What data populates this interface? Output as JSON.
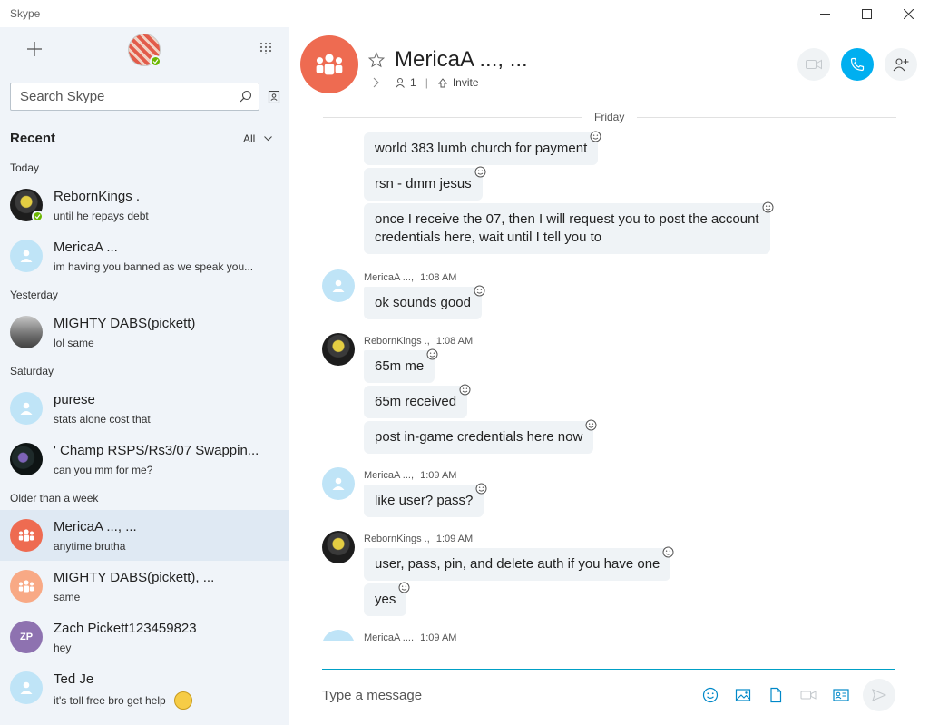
{
  "window": {
    "title": "Skype"
  },
  "sidebar": {
    "search": {
      "placeholder": "Search Skype"
    },
    "recent": {
      "title": "Recent",
      "filter": "All"
    },
    "sections": {
      "today": "Today",
      "yesterday": "Yesterday",
      "saturday": "Saturday",
      "older": "Older than a week"
    },
    "conversations": [
      {
        "name": "RebornKings .",
        "preview": "until he repays debt"
      },
      {
        "name": "MericaA ...",
        "preview": "im having you banned as we speak you..."
      },
      {
        "name": "MIGHTY DABS(pickett)",
        "preview": "lol same"
      },
      {
        "name": "purese",
        "preview": "stats alone cost that"
      },
      {
        "name": "' Champ RSPS/Rs3/07 Swappin...",
        "preview": "can you mm for me?"
      },
      {
        "name": "MericaA ..., ...",
        "preview": "anytime brutha"
      },
      {
        "name": "MIGHTY DABS(pickett), ...",
        "preview": "same"
      },
      {
        "name": "Zach Pickett123459823",
        "preview": "hey",
        "initials": "ZP"
      },
      {
        "name": "Ted Je",
        "preview": "it's toll free bro get help"
      }
    ]
  },
  "chat": {
    "title": "MericaA ..., ...",
    "participants": "1",
    "invite": "Invite",
    "day": "Friday",
    "messages": [
      {
        "text": "world 383 lumb church for payment"
      },
      {
        "text": "rsn - dmm jesus"
      },
      {
        "text": "once I receive the 07, then I will request you to post the account",
        "text2": "credentials here, wait until I tell you to"
      },
      {
        "sender": "MericaA ...,",
        "time": "1:08 AM",
        "text": "ok sounds good"
      },
      {
        "sender": "RebornKings .,",
        "time": "1:08 AM",
        "text": "65m me"
      },
      {
        "text": "65m received"
      },
      {
        "text": "post in-game credentials here now"
      },
      {
        "sender": "MericaA ...,",
        "time": "1:09 AM",
        "text": "like user? pass?"
      },
      {
        "sender": "RebornKings .,",
        "time": "1:09 AM",
        "text": "user, pass, pin, and delete auth if you have one"
      },
      {
        "text": "yes"
      },
      {
        "sender": "MericaA ...,",
        "time": "1:09 AM"
      }
    ],
    "composer": {
      "placeholder": "Type a message"
    }
  },
  "colors": {
    "accent": "#00aff0",
    "presence": "#6bb700",
    "group": "#ee6b51",
    "bubble": "#eff3f6"
  }
}
